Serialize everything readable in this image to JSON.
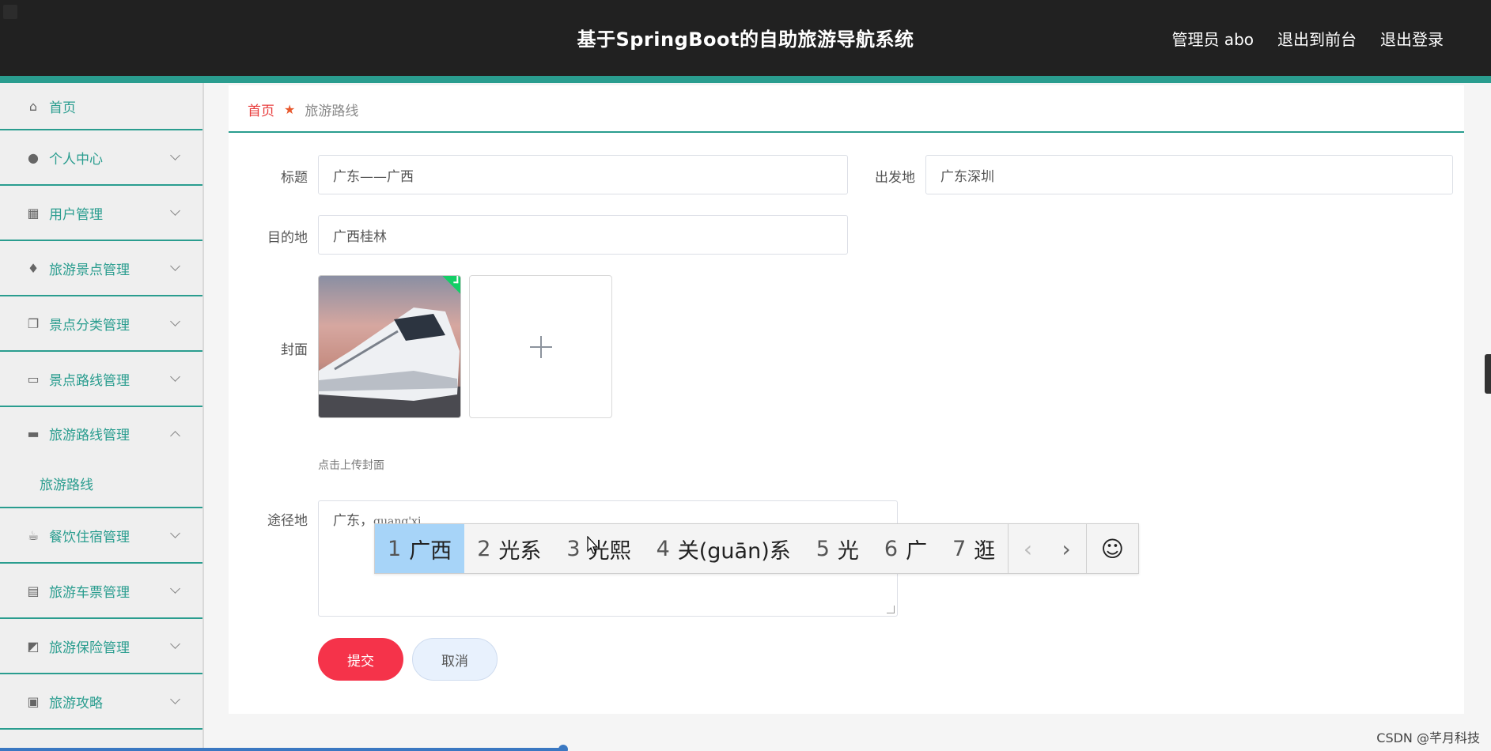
{
  "header": {
    "title": "基于SpringBoot的自助旅游导航系统",
    "user": "管理员 abo",
    "to_front": "退出到前台",
    "logout": "退出登录"
  },
  "sidebar": {
    "items": [
      {
        "label": "首页",
        "icon": "home-icon"
      },
      {
        "label": "个人中心",
        "icon": "user-icon"
      },
      {
        "label": "用户管理",
        "icon": "grid-icon"
      },
      {
        "label": "旅游景点管理",
        "icon": "mic-icon"
      },
      {
        "label": "景点分类管理",
        "icon": "copy-icon"
      },
      {
        "label": "景点路线管理",
        "icon": "chat-icon"
      },
      {
        "label": "旅游路线管理",
        "icon": "monitor-icon"
      },
      {
        "label": "餐饮住宿管理",
        "icon": "coffee-icon"
      },
      {
        "label": "旅游车票管理",
        "icon": "clipboard-icon"
      },
      {
        "label": "旅游保险管理",
        "icon": "chart-icon"
      },
      {
        "label": "旅游攻略",
        "icon": "card-icon"
      }
    ],
    "sub_item": "旅游路线"
  },
  "breadcrumb": {
    "home": "首页",
    "current": "旅游路线"
  },
  "form": {
    "title_label": "标题",
    "title_value": "广东——广西",
    "departure_label": "出发地",
    "departure_value": "广东深圳",
    "destination_label": "目的地",
    "destination_value": "广西桂林",
    "cover_label": "封面",
    "cover_hint": "点击上传封面",
    "via_label": "途径地",
    "via_value": "广东，",
    "via_composition": "guang'xi",
    "submit": "提交",
    "cancel": "取消"
  },
  "ime": {
    "candidates": [
      {
        "n": "1",
        "text": "广西"
      },
      {
        "n": "2",
        "text": "光系"
      },
      {
        "n": "3",
        "text": "光熙"
      },
      {
        "n": "4",
        "text": "关(guān)系"
      },
      {
        "n": "5",
        "text": "光"
      },
      {
        "n": "6",
        "text": "广"
      },
      {
        "n": "7",
        "text": "逛"
      }
    ],
    "prev": "‹",
    "next": "›",
    "emoji": "☺"
  },
  "watermark": "CSDN @芊月科技",
  "colors": {
    "header_bg": "#212121",
    "accent": "#2a9d8f",
    "submit": "#f5334a",
    "ime_selected": "#a7d4f8"
  }
}
